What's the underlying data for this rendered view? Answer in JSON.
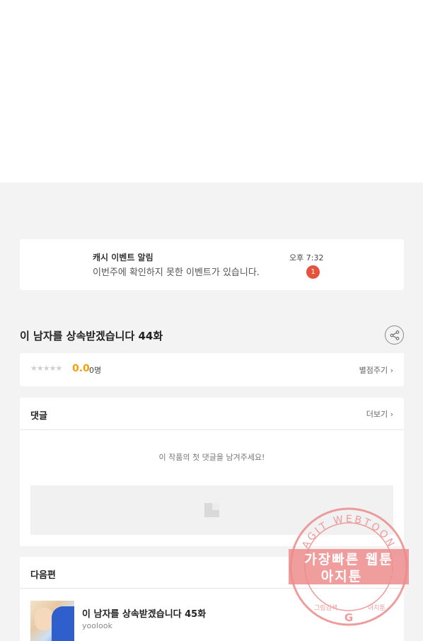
{
  "notification": {
    "title": "캐시 이벤트 알림",
    "time": "오후 7:32",
    "message": "이번주에 확인하지 못한 이벤트가 있습니다.",
    "badge_count": "1"
  },
  "episode": {
    "title": "이 남자를 상속받겠습니다 44화",
    "share_icon": "share-icon"
  },
  "rating": {
    "stars": "★★★★★",
    "score": "0.0",
    "count": "0명",
    "rate_link": "별점주기 ›",
    "rating_fraction": 0
  },
  "comments": {
    "header": "댓글",
    "more": "더보기 ›",
    "empty_message": "이 작품의 첫 댓글을 남겨주세요!"
  },
  "next_episode": {
    "header": "다음편",
    "title": "이 남자를 상속받겠습니다 45화",
    "author": "yoolook"
  },
  "watermark": {
    "ring_text": "AGIT WEBTOON",
    "line1": "가장빠른 웹툰",
    "line2": "아지툰",
    "bottom_left": "그림검색",
    "bottom_right": "아지툰"
  },
  "colors": {
    "accent_score": "#f0a10a",
    "badge": "#e5533c",
    "watermark": "#ec8c8c"
  }
}
